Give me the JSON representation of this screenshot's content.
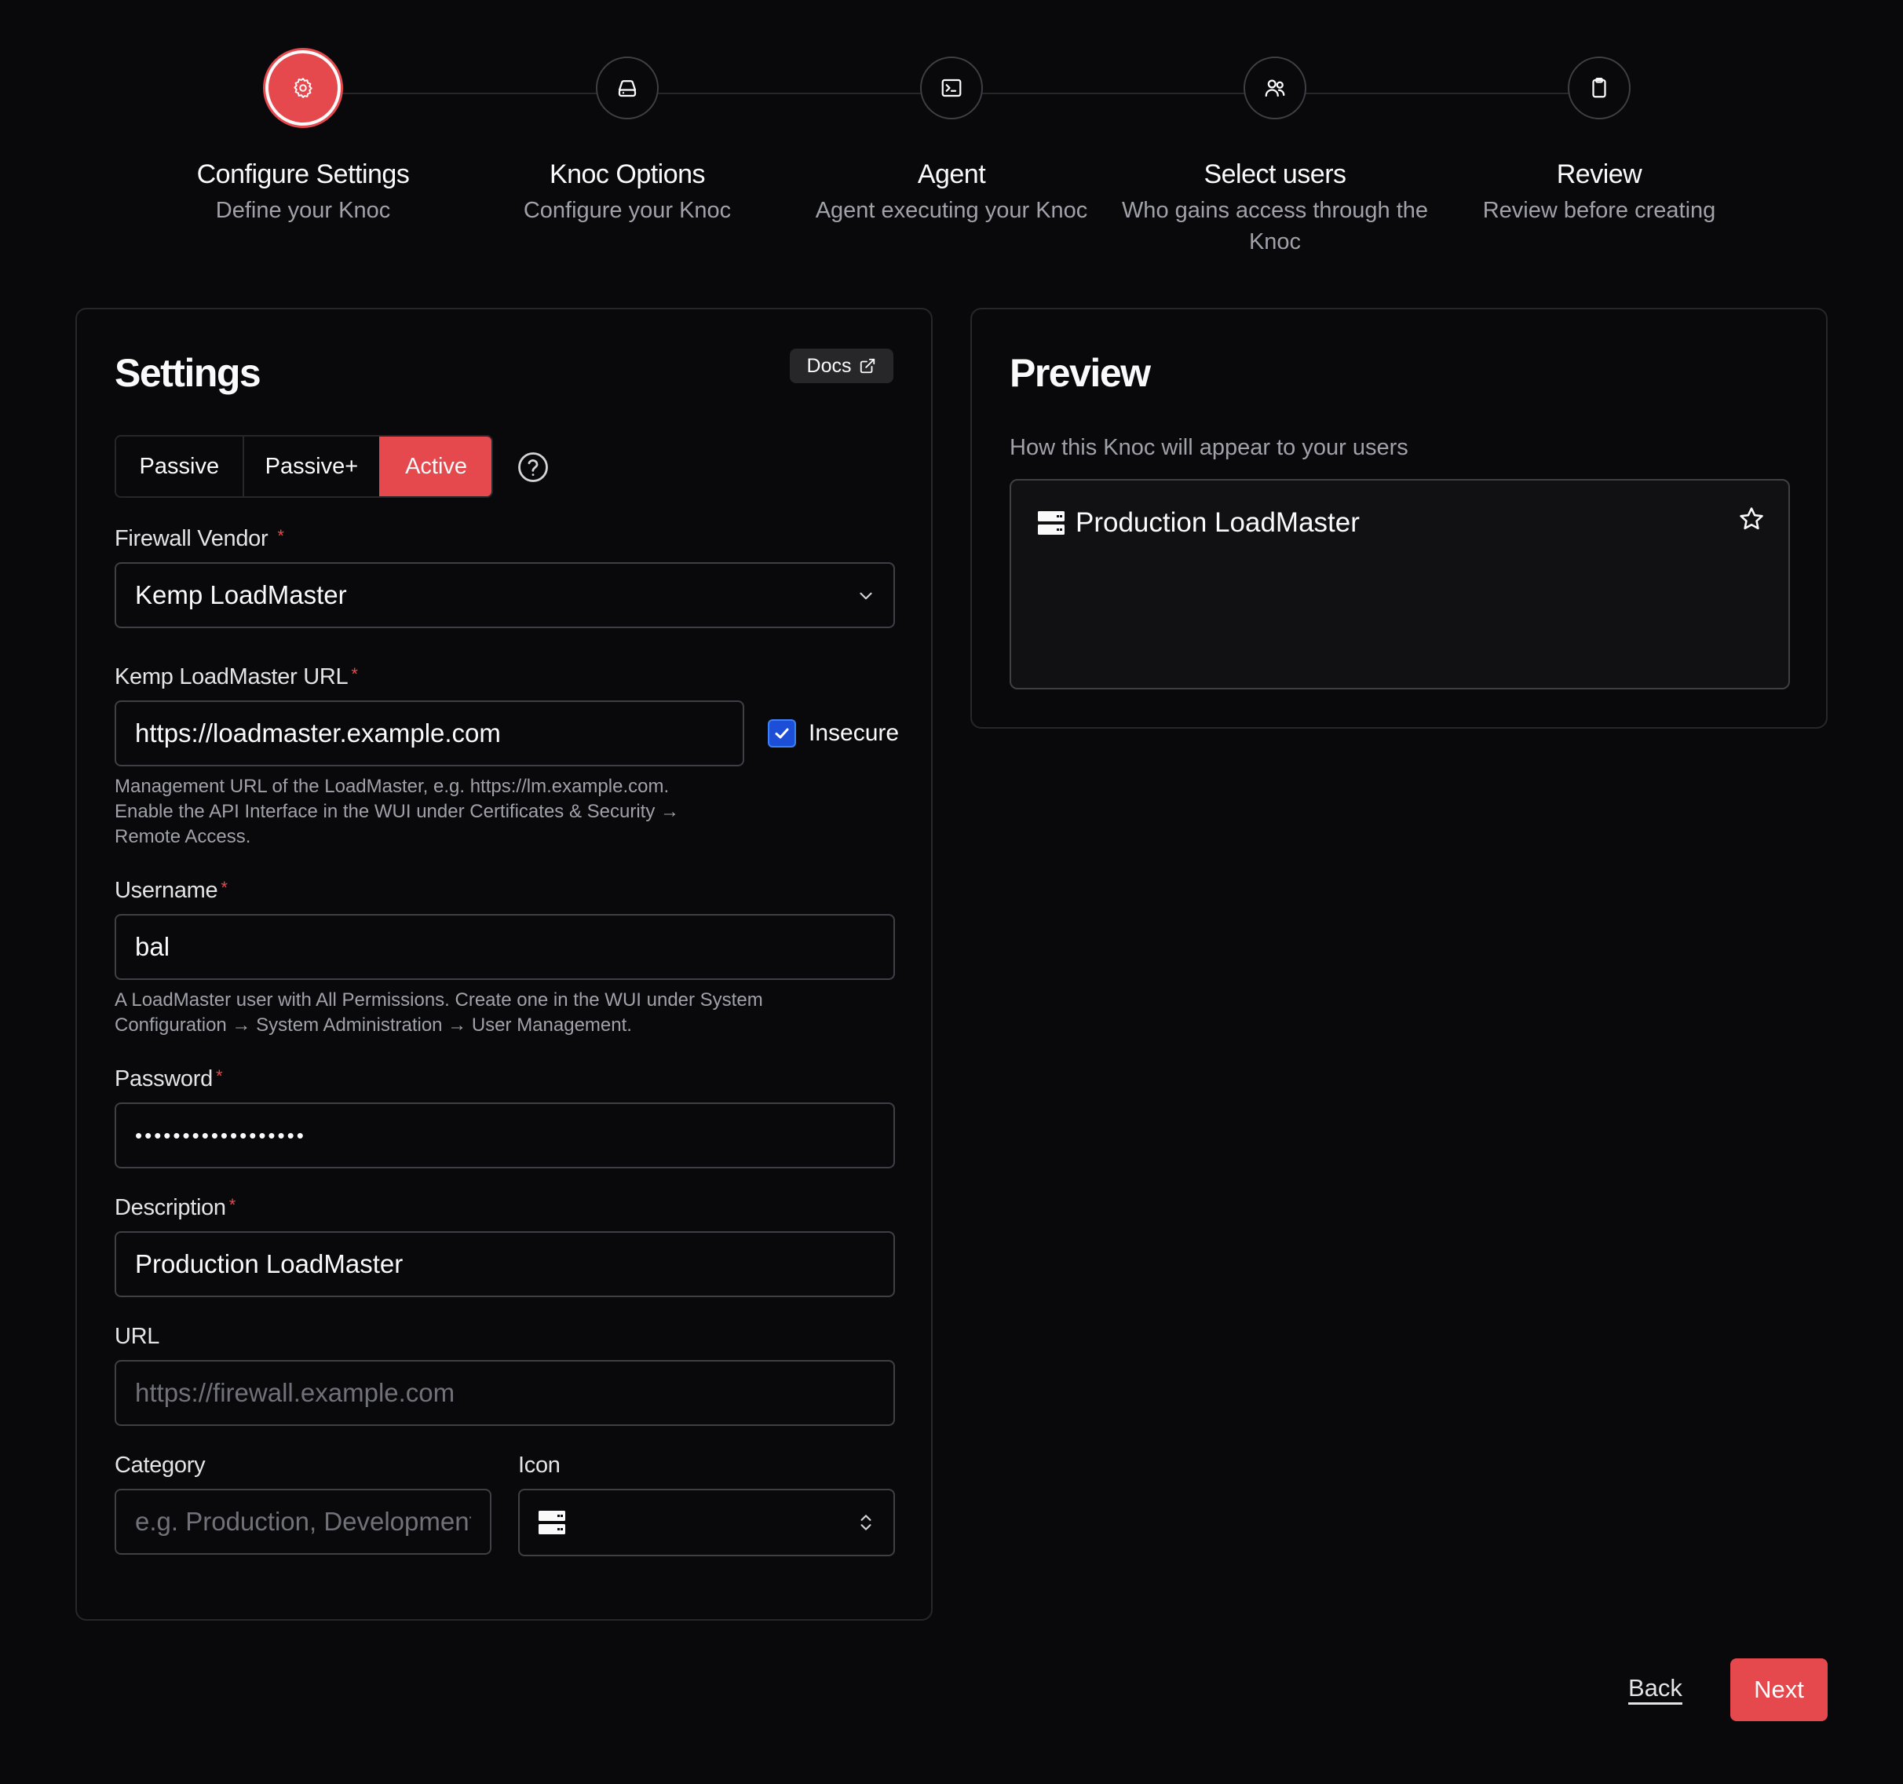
{
  "steps": [
    {
      "title": "Configure Settings",
      "subtitle": "Define your Knoc",
      "icon": "gear-icon",
      "active": true
    },
    {
      "title": "Knoc Options",
      "subtitle": "Configure your Knoc",
      "icon": "hard-drive-icon",
      "active": false
    },
    {
      "title": "Agent",
      "subtitle": "Agent executing your Knoc",
      "icon": "terminal-icon",
      "active": false
    },
    {
      "title": "Select users",
      "subtitle": "Who gains access through the Knoc",
      "icon": "users-icon",
      "active": false
    },
    {
      "title": "Review",
      "subtitle": "Review before creating",
      "icon": "clipboard-icon",
      "active": false
    }
  ],
  "settings": {
    "title": "Settings",
    "docs_label": "Docs",
    "modes": [
      "Passive",
      "Passive+",
      "Active"
    ],
    "selected_mode": "Active",
    "firewall_vendor": {
      "label": "Firewall Vendor",
      "value": "Kemp LoadMaster"
    },
    "url_field": {
      "label": "Kemp LoadMaster URL",
      "value": "https://loadmaster.example.com",
      "insecure_label": "Insecure",
      "insecure_checked": true,
      "hint_line1": "Management URL of the LoadMaster, e.g. https://lm.example.com.",
      "hint_line2": "Enable the API Interface in the WUI under Certificates & Security →",
      "hint_line3": "Remote Access."
    },
    "username": {
      "label": "Username",
      "value": "bal",
      "hint_line1": "A LoadMaster user with All Permissions. Create one in the WUI under System",
      "hint_line2": "Configuration → System Administration → User Management."
    },
    "password": {
      "label": "Password",
      "value": "••••••••••••••••••"
    },
    "description": {
      "label": "Description",
      "value": "Production LoadMaster"
    },
    "url": {
      "label": "URL",
      "placeholder": "https://firewall.example.com"
    },
    "category": {
      "label": "Category",
      "placeholder": "e.g. Production, Development"
    },
    "icon": {
      "label": "Icon",
      "value": "server-icon"
    }
  },
  "preview": {
    "title": "Preview",
    "subtitle": "How this Knoc will appear to your users",
    "tile_title": "Production LoadMaster"
  },
  "footer": {
    "back_label": "Back",
    "next_label": "Next"
  },
  "colors": {
    "accent": "#e5484d",
    "background": "#09090b",
    "border": "#27272a",
    "checkbox": "#1d4ed8"
  }
}
